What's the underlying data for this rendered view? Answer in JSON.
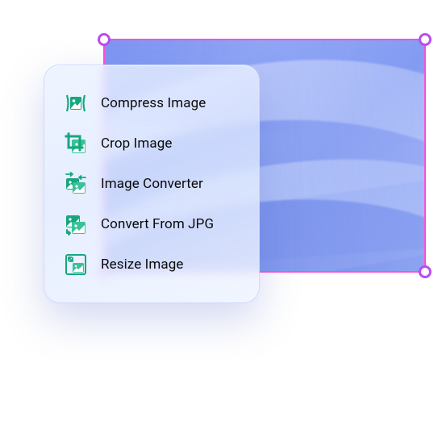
{
  "colors": {
    "selection_border": "#ff4fd8",
    "handle_border": "#b84df2",
    "icon_primary": "#16a77e",
    "icon_secondary": "#39c29a"
  },
  "menu": {
    "items": [
      {
        "label": "Compress Image",
        "icon": "compress-icon"
      },
      {
        "label": "Crop Image",
        "icon": "crop-icon"
      },
      {
        "label": "Image Converter",
        "icon": "converter-icon"
      },
      {
        "label": "Convert From JPG",
        "icon": "convert-from-jpg-icon"
      },
      {
        "label": "Resize Image",
        "icon": "resize-icon"
      }
    ]
  }
}
